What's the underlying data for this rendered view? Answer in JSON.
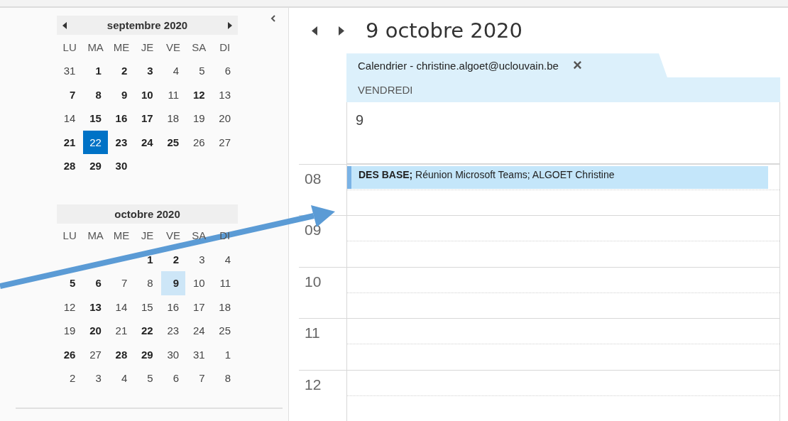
{
  "months": [
    {
      "title": "septembre 2020",
      "nav": true,
      "first_week_right": false,
      "weekdays": [
        "LU",
        "MA",
        "ME",
        "JE",
        "VE",
        "SA",
        "DI"
      ],
      "weeks": [
        [
          {
            "d": "31",
            "bold": false,
            "today": false,
            "selected": false
          },
          {
            "d": "1",
            "bold": true,
            "today": false,
            "selected": false
          },
          {
            "d": "2",
            "bold": true,
            "today": false,
            "selected": false
          },
          {
            "d": "3",
            "bold": true,
            "today": false,
            "selected": false
          },
          {
            "d": "4",
            "bold": false,
            "today": false,
            "selected": false
          },
          {
            "d": "5",
            "bold": false,
            "today": false,
            "selected": false
          },
          {
            "d": "6",
            "bold": false,
            "today": false,
            "selected": false
          }
        ],
        [
          {
            "d": "7",
            "bold": true,
            "today": false,
            "selected": false
          },
          {
            "d": "8",
            "bold": true,
            "today": false,
            "selected": false
          },
          {
            "d": "9",
            "bold": true,
            "today": false,
            "selected": false
          },
          {
            "d": "10",
            "bold": true,
            "today": false,
            "selected": false
          },
          {
            "d": "11",
            "bold": false,
            "today": false,
            "selected": false
          },
          {
            "d": "12",
            "bold": true,
            "today": false,
            "selected": false
          },
          {
            "d": "13",
            "bold": false,
            "today": false,
            "selected": false
          }
        ],
        [
          {
            "d": "14",
            "bold": false,
            "today": false,
            "selected": false
          },
          {
            "d": "15",
            "bold": true,
            "today": false,
            "selected": false
          },
          {
            "d": "16",
            "bold": true,
            "today": false,
            "selected": false
          },
          {
            "d": "17",
            "bold": true,
            "today": false,
            "selected": false
          },
          {
            "d": "18",
            "bold": false,
            "today": false,
            "selected": false
          },
          {
            "d": "19",
            "bold": false,
            "today": false,
            "selected": false
          },
          {
            "d": "20",
            "bold": false,
            "today": false,
            "selected": false
          }
        ],
        [
          {
            "d": "21",
            "bold": true,
            "today": false,
            "selected": false
          },
          {
            "d": "22",
            "bold": false,
            "today": true,
            "selected": false
          },
          {
            "d": "23",
            "bold": true,
            "today": false,
            "selected": false
          },
          {
            "d": "24",
            "bold": true,
            "today": false,
            "selected": false
          },
          {
            "d": "25",
            "bold": true,
            "today": false,
            "selected": false
          },
          {
            "d": "26",
            "bold": false,
            "today": false,
            "selected": false
          },
          {
            "d": "27",
            "bold": false,
            "today": false,
            "selected": false
          }
        ],
        [
          {
            "d": "28",
            "bold": true,
            "today": false,
            "selected": false
          },
          {
            "d": "29",
            "bold": true,
            "today": false,
            "selected": false
          },
          {
            "d": "30",
            "bold": true,
            "today": false,
            "selected": false
          }
        ]
      ]
    },
    {
      "title": "octobre 2020",
      "nav": false,
      "first_week_right": true,
      "weekdays": [
        "LU",
        "MA",
        "ME",
        "JE",
        "VE",
        "SA",
        "DI"
      ],
      "weeks": [
        [
          {
            "d": "1",
            "bold": true,
            "today": false,
            "selected": false
          },
          {
            "d": "2",
            "bold": true,
            "today": false,
            "selected": false
          },
          {
            "d": "3",
            "bold": false,
            "today": false,
            "selected": false
          },
          {
            "d": "4",
            "bold": false,
            "today": false,
            "selected": false
          }
        ],
        [
          {
            "d": "5",
            "bold": true,
            "today": false,
            "selected": false
          },
          {
            "d": "6",
            "bold": true,
            "today": false,
            "selected": false
          },
          {
            "d": "7",
            "bold": false,
            "today": false,
            "selected": false
          },
          {
            "d": "8",
            "bold": false,
            "today": false,
            "selected": false
          },
          {
            "d": "9",
            "bold": true,
            "today": false,
            "selected": true
          },
          {
            "d": "10",
            "bold": false,
            "today": false,
            "selected": false
          },
          {
            "d": "11",
            "bold": false,
            "today": false,
            "selected": false
          }
        ],
        [
          {
            "d": "12",
            "bold": false,
            "today": false,
            "selected": false
          },
          {
            "d": "13",
            "bold": true,
            "today": false,
            "selected": false
          },
          {
            "d": "14",
            "bold": false,
            "today": false,
            "selected": false
          },
          {
            "d": "15",
            "bold": false,
            "today": false,
            "selected": false
          },
          {
            "d": "16",
            "bold": false,
            "today": false,
            "selected": false
          },
          {
            "d": "17",
            "bold": false,
            "today": false,
            "selected": false
          },
          {
            "d": "18",
            "bold": false,
            "today": false,
            "selected": false
          }
        ],
        [
          {
            "d": "19",
            "bold": false,
            "today": false,
            "selected": false
          },
          {
            "d": "20",
            "bold": true,
            "today": false,
            "selected": false
          },
          {
            "d": "21",
            "bold": false,
            "today": false,
            "selected": false
          },
          {
            "d": "22",
            "bold": true,
            "today": false,
            "selected": false
          },
          {
            "d": "23",
            "bold": false,
            "today": false,
            "selected": false
          },
          {
            "d": "24",
            "bold": false,
            "today": false,
            "selected": false
          },
          {
            "d": "25",
            "bold": false,
            "today": false,
            "selected": false
          }
        ],
        [
          {
            "d": "26",
            "bold": true,
            "today": false,
            "selected": false
          },
          {
            "d": "27",
            "bold": false,
            "today": false,
            "selected": false
          },
          {
            "d": "28",
            "bold": true,
            "today": false,
            "selected": false
          },
          {
            "d": "29",
            "bold": true,
            "today": false,
            "selected": false
          },
          {
            "d": "30",
            "bold": false,
            "today": false,
            "selected": false
          },
          {
            "d": "31",
            "bold": false,
            "today": false,
            "selected": false
          },
          {
            "d": "1",
            "bold": false,
            "today": false,
            "selected": false
          }
        ],
        [
          {
            "d": "2",
            "bold": false,
            "today": false,
            "selected": false
          },
          {
            "d": "3",
            "bold": false,
            "today": false,
            "selected": false
          },
          {
            "d": "4",
            "bold": false,
            "today": false,
            "selected": false
          },
          {
            "d": "5",
            "bold": false,
            "today": false,
            "selected": false
          },
          {
            "d": "6",
            "bold": false,
            "today": false,
            "selected": false
          },
          {
            "d": "7",
            "bold": false,
            "today": false,
            "selected": false
          },
          {
            "d": "8",
            "bold": false,
            "today": false,
            "selected": false
          }
        ]
      ]
    }
  ],
  "view": {
    "title": "9 octobre 2020",
    "tab": {
      "label": "Calendrier - christine.algoet@uclouvain.be",
      "close": "×"
    },
    "weekday": "VENDREDI",
    "day": "9",
    "hours": [
      {
        "label": "08",
        "event": "**DES BASE;** Réunion Microsoft Teams; ALGOET Christine"
      },
      {
        "label": "09"
      },
      {
        "label": "10"
      },
      {
        "label": "11"
      },
      {
        "label": "12"
      }
    ]
  }
}
